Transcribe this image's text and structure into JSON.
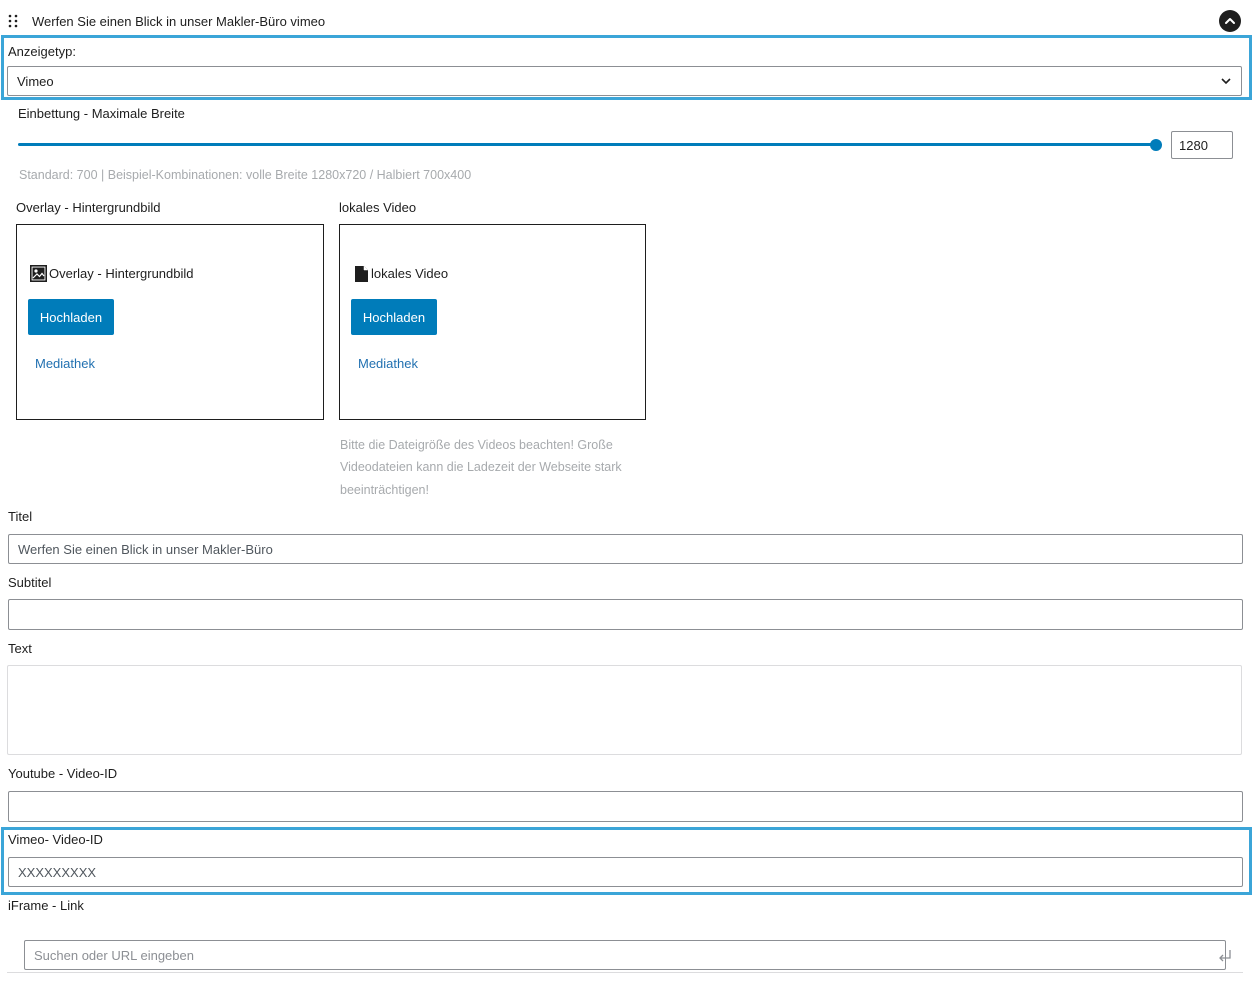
{
  "header": {
    "title": "Werfen Sie einen Blick in unser Makler-Büro vimeo"
  },
  "display_type": {
    "label": "Anzeigetyp:",
    "value": "Vimeo"
  },
  "embed_width": {
    "label": "Einbettung - Maximale Breite",
    "value": "1280",
    "slider_fraction": 1.0,
    "help": "Standard: 700 | Beispiel-Kombinationen: volle Breite 1280x720 / Halbiert 700x400"
  },
  "overlay": {
    "label": "Overlay - Hintergrundbild",
    "box_title": "Overlay - Hintergrundbild",
    "upload_label": "Hochladen",
    "library_label": "Mediathek"
  },
  "local_video": {
    "label": "lokales Video",
    "box_title": "lokales Video",
    "upload_label": "Hochladen",
    "library_label": "Mediathek",
    "help_line1": "Bitte die Dateigröße des Videos beachten! Große",
    "help_line2": "Videodateien kann die Ladezeit der Webseite stark",
    "help_line3": "beeinträchtigen!"
  },
  "title_field": {
    "label": "Titel",
    "value": "Werfen Sie einen Blick in unser Makler-Büro"
  },
  "subtitle_field": {
    "label": "Subtitel",
    "value": ""
  },
  "text_field": {
    "label": "Text",
    "value": ""
  },
  "youtube_field": {
    "label": "Youtube - Video-ID",
    "value": ""
  },
  "vimeo_field": {
    "label": "Vimeo- Video-ID",
    "value": "XXXXXXXXX"
  },
  "iframe_field": {
    "label": "iFrame - Link",
    "placeholder": "Suchen oder URL eingeben"
  },
  "colors": {
    "accent": "#007cba",
    "highlight": "#3ba5d8",
    "link": "#2271b1"
  }
}
